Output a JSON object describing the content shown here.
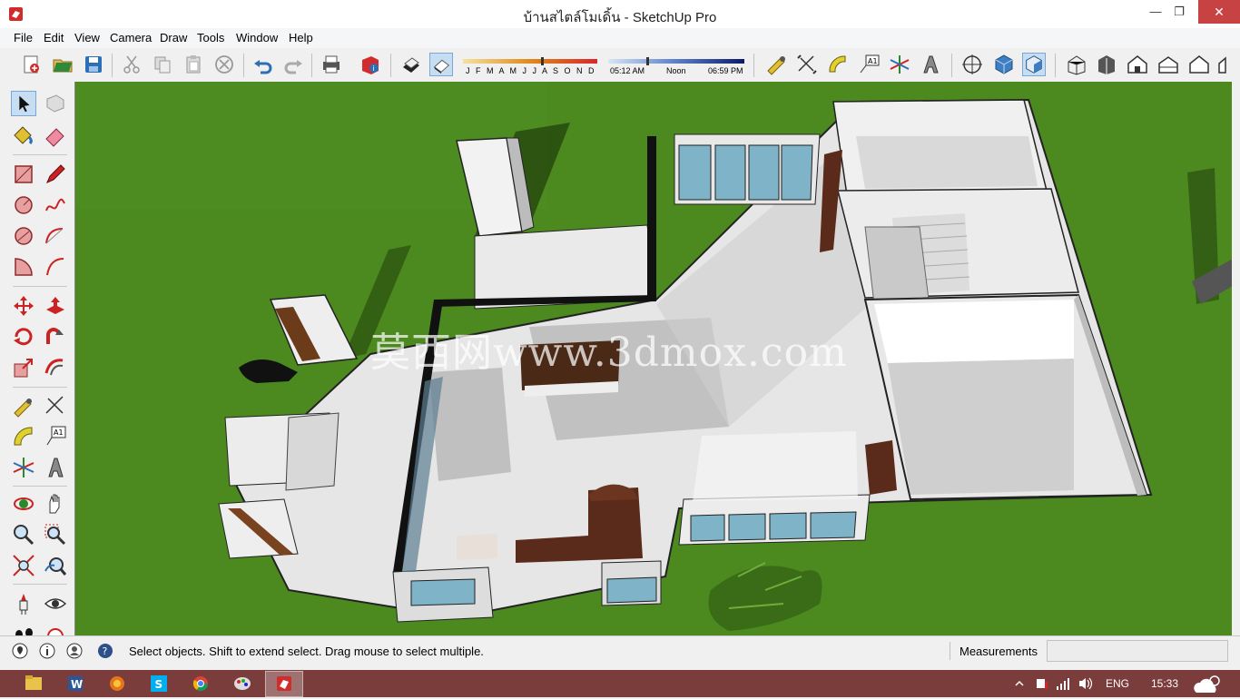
{
  "window": {
    "title": "บ้านสไตล์โมเดิ้น - SketchUp Pro",
    "minimize_glyph": "—",
    "restore_glyph": "❐",
    "close_glyph": "✕"
  },
  "menu": {
    "items": [
      "File",
      "Edit",
      "View",
      "Camera",
      "Draw",
      "Tools",
      "Window",
      "Help"
    ]
  },
  "shadow": {
    "months": "J F M A M J J A S O N D",
    "time_start": "05:12 AM",
    "time_mid": "Noon",
    "time_end": "06:59 PM"
  },
  "toolbar": {
    "icons": [
      "new-file-icon",
      "open-folder-icon",
      "save-icon",
      "cut-icon",
      "copy-icon",
      "paste-icon",
      "erase-selection-icon",
      "undo-icon",
      "redo-icon",
      "print-icon",
      "model-info-icon",
      "shadows-toggle-icon",
      "fog-icon",
      "tape-measure-icon",
      "dimension-icon",
      "protractor-icon",
      "text-label-icon",
      "axes-icon",
      "3d-text-icon",
      "position-camera-icon",
      "walk-icon",
      "look-around-icon",
      "iso-view-icon",
      "top-view-icon",
      "front-view-icon",
      "right-view-icon",
      "back-view-icon",
      "left-view-icon"
    ]
  },
  "left_toolbar": {
    "icons": [
      "select-arrow-icon",
      "component-icon",
      "paint-bucket-icon",
      "eraser-icon",
      "rectangle-icon",
      "pencil-icon",
      "circle-icon",
      "freehand-icon",
      "polygon-icon",
      "arc-icon",
      "pie-icon",
      "two-point-arc-icon",
      "move-icon",
      "push-pull-icon",
      "rotate-icon",
      "follow-me-icon",
      "scale-icon",
      "offset-icon",
      "tape-measure-icon",
      "dimension-icon",
      "protractor-icon",
      "text-icon",
      "axes-icon",
      "3d-text-icon",
      "orbit-icon",
      "pan-icon",
      "zoom-icon",
      "zoom-window-icon",
      "zoom-extents-icon",
      "previous-view-icon",
      "position-camera-icon",
      "look-around-icon",
      "walk-icon",
      "section-plane-icon"
    ]
  },
  "viewport": {
    "watermark": "莫西网www.3dmox.com"
  },
  "status": {
    "message": "Select objects. Shift to extend select. Drag mouse to select multiple.",
    "measurements_label": "Measurements",
    "measurements_value": ""
  },
  "taskbar": {
    "apps": [
      "file-explorer-icon",
      "word-icon",
      "firefox-icon",
      "skype-icon",
      "chrome-icon",
      "paint-icon",
      "sketchup-icon"
    ],
    "word_glyph": "W",
    "skype_glyph": "S",
    "language": "ENG",
    "clock": "15:33"
  },
  "colors": {
    "grass": "#4c8a1f",
    "taskbar": "#7b3c3c",
    "close_button": "#c74343",
    "active_tool": "#c7ddf2"
  }
}
